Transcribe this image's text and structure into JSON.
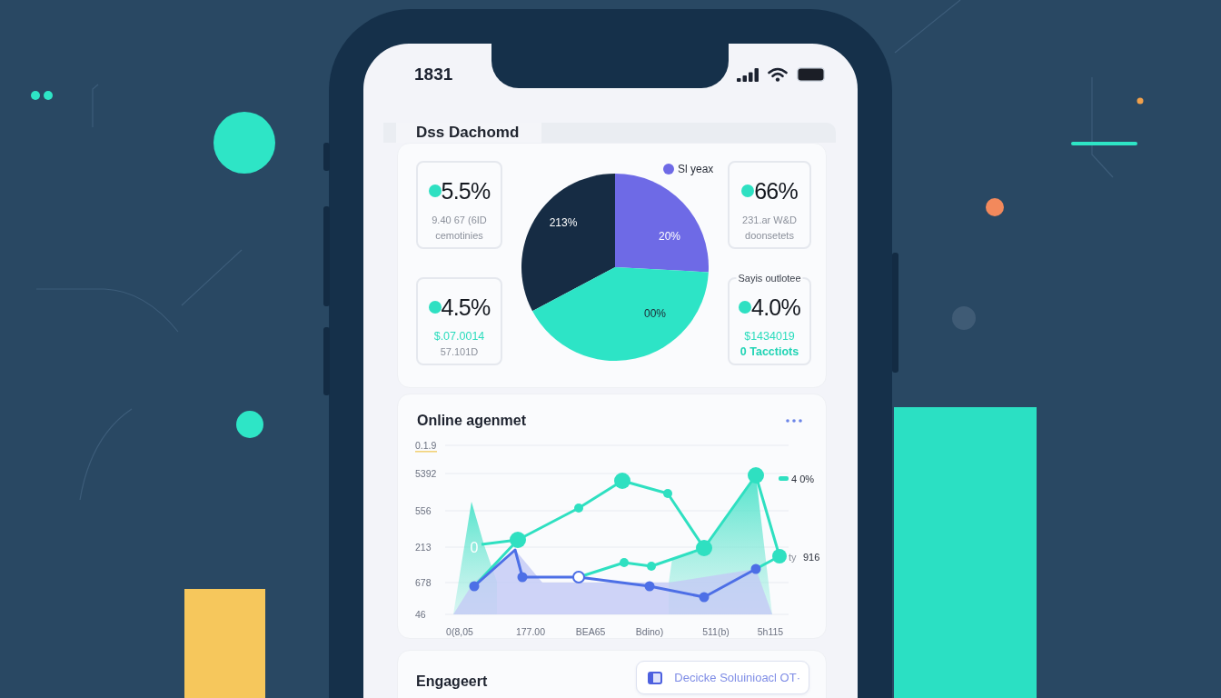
{
  "status_bar": {
    "time": "1831"
  },
  "header": {
    "title": "Dss Dachomd"
  },
  "overview": {
    "left_stats": [
      {
        "value": "5.5%",
        "lines": [
          {
            "kind": "muted",
            "text": "9.40 67 (6ID"
          },
          {
            "kind": "muted",
            "text": "cemotinies"
          }
        ]
      },
      {
        "value": "4.5%",
        "lines": [
          {
            "kind": "accent",
            "text": "$.07.0014"
          },
          {
            "kind": "muted",
            "text": "57.101D"
          }
        ]
      }
    ],
    "pie": {
      "legend": {
        "label": "Sl yeax",
        "color": "#6e6ae6"
      },
      "slices": [
        {
          "label": "213%",
          "color": "#162c44"
        },
        {
          "label": "20%",
          "color": "#6e6ae6"
        },
        {
          "label": "00%",
          "color": "#2de4c6"
        }
      ]
    },
    "right_stats": [
      {
        "value": "66%",
        "lines": [
          {
            "kind": "muted",
            "text": "231.ar W&D"
          },
          {
            "kind": "muted",
            "text": "doonsetets"
          }
        ]
      },
      {
        "caption": "Sayis outlotee",
        "value": "4.0%",
        "lines": [
          {
            "kind": "accent",
            "text": "$1434019"
          },
          {
            "kind": "accent-strong",
            "text": "0 Tacctiots"
          }
        ]
      }
    ]
  },
  "trend": {
    "title": "Online agenmet",
    "y_ticks": [
      "0.1.9",
      "5392",
      "556",
      "213",
      "678",
      "46"
    ],
    "x_labels": [
      "0(8,05",
      "177.00",
      "BEA65",
      "Bdino)",
      "511(b)",
      "5h115"
    ],
    "legend": {
      "label": "4 0%"
    },
    "point_label": "0",
    "side_labels": [
      "ty",
      "916"
    ]
  },
  "engagement": {
    "title": "Engageert",
    "button": {
      "label": "Decicke Soluinioacl OT·"
    }
  }
}
